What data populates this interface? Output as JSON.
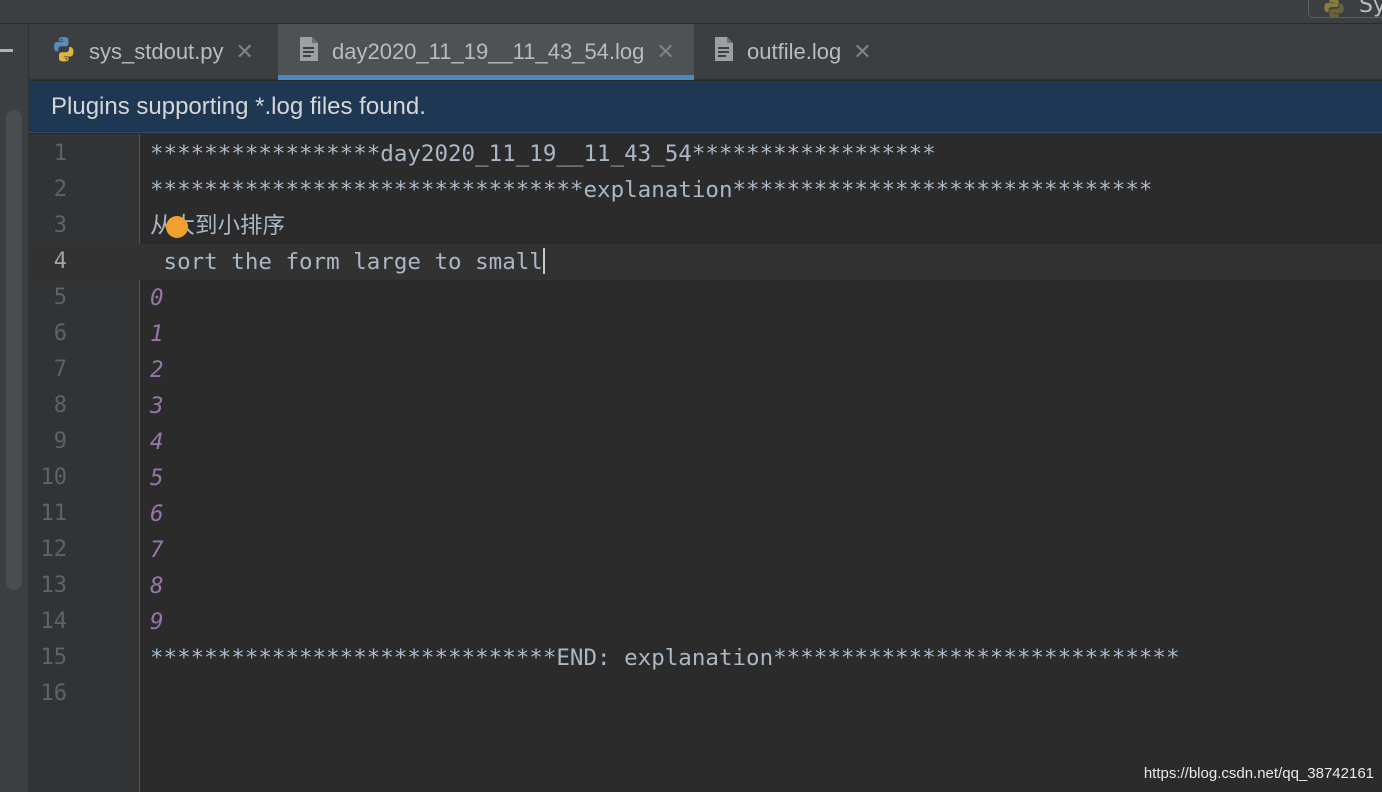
{
  "top_chip": {
    "text": "Sy"
  },
  "tabs": [
    {
      "label": "sys_stdout.py",
      "icon": "python-file-icon",
      "active": false
    },
    {
      "label": "day2020_11_19__11_43_54.log",
      "icon": "text-file-icon",
      "active": true
    },
    {
      "label": "outfile.log",
      "icon": "text-file-icon",
      "active": false
    }
  ],
  "close_glyph": "✕",
  "banner": {
    "text": "Plugins supporting *.log files found."
  },
  "editor": {
    "current_line": 4,
    "lines": [
      {
        "n": "1",
        "text": "*****************day2020_11_19__11_43_54******************"
      },
      {
        "n": "2",
        "text": "********************************explanation*******************************"
      },
      {
        "n": "3",
        "text": "从大到小排序"
      },
      {
        "n": "4",
        "text": " sort the form large to small"
      },
      {
        "n": "5",
        "text": "0"
      },
      {
        "n": "6",
        "text": "1"
      },
      {
        "n": "7",
        "text": "2"
      },
      {
        "n": "8",
        "text": "3"
      },
      {
        "n": "9",
        "text": "4"
      },
      {
        "n": "10",
        "text": "5"
      },
      {
        "n": "11",
        "text": "6"
      },
      {
        "n": "12",
        "text": "7"
      },
      {
        "n": "13",
        "text": "8"
      },
      {
        "n": "14",
        "text": "9"
      },
      {
        "n": "15",
        "text": "******************************END: explanation******************************"
      },
      {
        "n": "16",
        "text": ""
      }
    ]
  },
  "watermark": "https://blog.csdn.net/qq_38742161",
  "colors": {
    "background": "#2b2b2b",
    "tab_underline": "#4a88c7",
    "banner": "#1e3752",
    "number_literal": "#9876aa",
    "text": "#a9b7c6",
    "marker": "#f0a030"
  }
}
